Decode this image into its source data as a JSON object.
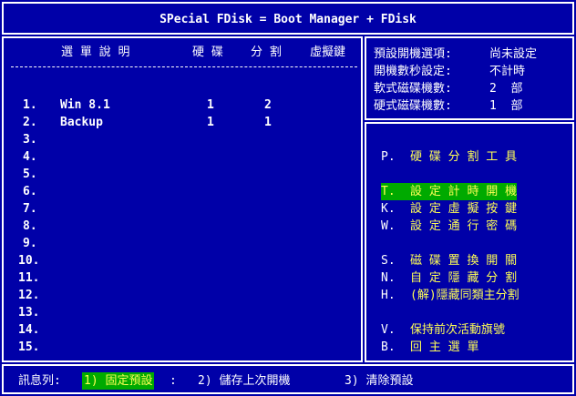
{
  "header": {
    "title": "SPecial FDisk = Boot Manager + FDisk"
  },
  "table": {
    "columns": [
      "選 單 說 明",
      "硬 碟",
      "分 割",
      "虛擬鍵"
    ],
    "rows": [
      {
        "num": "1.",
        "name": "Win 8.1",
        "disk": "1",
        "part": "2",
        "vkey": ""
      },
      {
        "num": "2.",
        "name": "Backup",
        "disk": "1",
        "part": "1",
        "vkey": ""
      },
      {
        "num": "3.",
        "name": "",
        "disk": "",
        "part": "",
        "vkey": ""
      },
      {
        "num": "4.",
        "name": "",
        "disk": "",
        "part": "",
        "vkey": ""
      },
      {
        "num": "5.",
        "name": "",
        "disk": "",
        "part": "",
        "vkey": ""
      },
      {
        "num": "6.",
        "name": "",
        "disk": "",
        "part": "",
        "vkey": ""
      },
      {
        "num": "7.",
        "name": "",
        "disk": "",
        "part": "",
        "vkey": ""
      },
      {
        "num": "8.",
        "name": "",
        "disk": "",
        "part": "",
        "vkey": ""
      },
      {
        "num": "9.",
        "name": "",
        "disk": "",
        "part": "",
        "vkey": ""
      },
      {
        "num": "10.",
        "name": "",
        "disk": "",
        "part": "",
        "vkey": ""
      },
      {
        "num": "11.",
        "name": "",
        "disk": "",
        "part": "",
        "vkey": ""
      },
      {
        "num": "12.",
        "name": "",
        "disk": "",
        "part": "",
        "vkey": ""
      },
      {
        "num": "13.",
        "name": "",
        "disk": "",
        "part": "",
        "vkey": ""
      },
      {
        "num": "14.",
        "name": "",
        "disk": "",
        "part": "",
        "vkey": ""
      },
      {
        "num": "15.",
        "name": "",
        "disk": "",
        "part": "",
        "vkey": ""
      }
    ]
  },
  "info": [
    {
      "label": "預設開機選項:",
      "value": "尚未設定"
    },
    {
      "label": "開機數秒設定:",
      "value": "不計時"
    },
    {
      "label": "軟式磁碟機數:",
      "value": "2  部"
    },
    {
      "label": "硬式磁碟機數:",
      "value": "1  部"
    }
  ],
  "menu": [
    {
      "key": "P.",
      "label": "硬 碟 分 割 工 具",
      "selected": false
    },
    {
      "key": "T.",
      "label": "設 定 計 時 開 機",
      "selected": true
    },
    {
      "key": "K.",
      "label": "設 定 虛 擬 按 鍵",
      "selected": false
    },
    {
      "key": "W.",
      "label": "設 定 通 行 密 碼",
      "selected": false
    },
    {
      "key": "S.",
      "label": "磁 碟 置 換 開 關",
      "selected": false
    },
    {
      "key": "N.",
      "label": "自 定 隱 藏 分 割",
      "selected": false
    },
    {
      "key": "H.",
      "label": "(解)隱藏同類主分割",
      "selected": false
    },
    {
      "key": "V.",
      "label": "保持前次活動旗號",
      "selected": false
    },
    {
      "key": "B.",
      "label": "回 主 選 單",
      "selected": false
    }
  ],
  "status": {
    "label": "訊息列:",
    "options": [
      "1) 固定預設",
      "2) 儲存上次開機",
      "3) 清除預設"
    ],
    "selected_index": 0
  },
  "colors": {
    "background": "#0000a8",
    "text": "#ffffff",
    "accent": "#ffff55",
    "highlight": "#00aa00"
  }
}
